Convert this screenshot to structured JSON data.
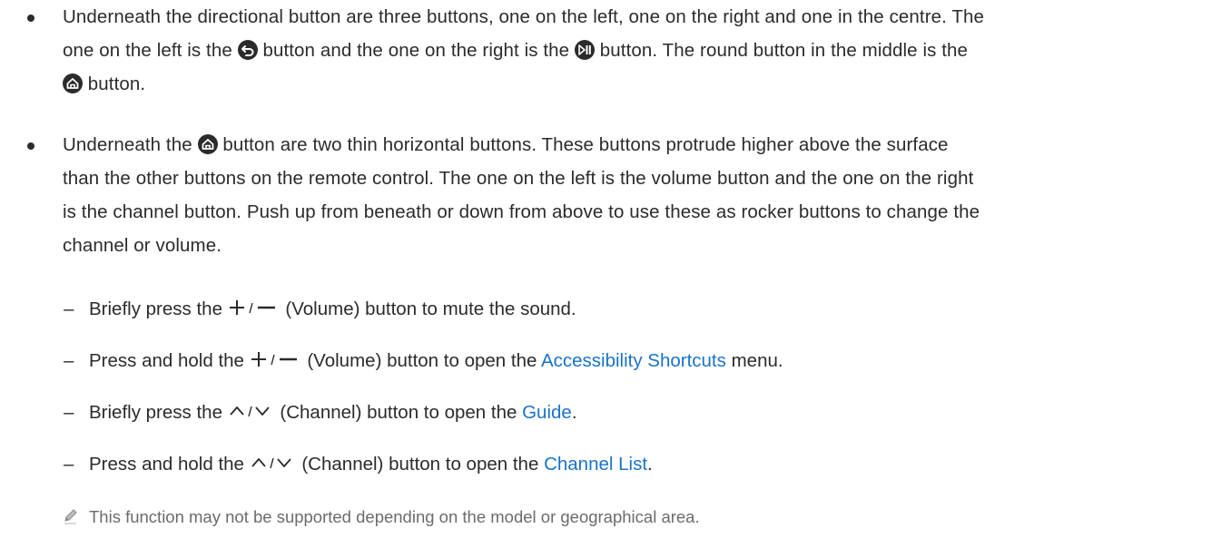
{
  "bullets": [
    {
      "lines": [
        {
          "text": "Underneath the directional button are three buttons, one on the left, one on the right and one in the centre. The"
        },
        {
          "a": "one on the left is the",
          "b": "button and the one on the right is the",
          "c": "button. The round button in the middle is the"
        },
        {
          "a": "button."
        }
      ]
    },
    {
      "lines": [
        {
          "a": "Underneath the",
          "b": "button are two thin horizontal buttons. These buttons protrude higher above the surface"
        },
        {
          "text": "than the other buttons on the remote control. The one on the left is the volume button and the one on the right"
        },
        {
          "text": "is the channel button. Push up from beneath or down from above to use these as rocker buttons to change the"
        },
        {
          "text": "channel or volume."
        }
      ]
    }
  ],
  "icons": {
    "back": "back-icon",
    "play_pause": "play-pause-icon",
    "home": "home-icon",
    "volume": "volume-plus-minus-icon",
    "channel": "channel-up-down-icon",
    "note": "pencil-icon"
  },
  "subitems": [
    {
      "dash": "–",
      "a": "Briefly press the",
      "b": "(Volume) button to mute the sound."
    },
    {
      "dash": "–",
      "a": "Press and hold the",
      "b": "(Volume) button to open the",
      "link": "Accessibility Shortcuts",
      "c": "menu."
    },
    {
      "dash": "–",
      "a": "Briefly press the",
      "b": "(Channel) button to open the",
      "link": "Guide",
      "c": "."
    },
    {
      "dash": "–",
      "a": "Press and hold the",
      "b": "(Channel) button to open the",
      "link": "Channel List",
      "c": "."
    }
  ],
  "note": "This function may not be supported depending on the model or geographical area.",
  "colors": {
    "text": "#2b2b2b",
    "link": "#1a73c9",
    "note": "#6b6b6b"
  }
}
